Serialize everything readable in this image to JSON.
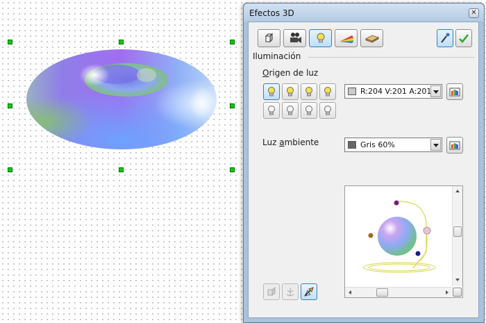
{
  "dialog": {
    "title": "Efectos 3D",
    "close_icon": "close-icon",
    "tabs": [
      {
        "name": "geometry",
        "icon": "cube-icon",
        "active": false
      },
      {
        "name": "shading",
        "icon": "camera-icon",
        "active": false
      },
      {
        "name": "illumination",
        "icon": "lightbulb-icon",
        "active": true
      },
      {
        "name": "textures",
        "icon": "rainbow-icon",
        "active": false
      },
      {
        "name": "material",
        "icon": "material-icon",
        "active": false
      }
    ],
    "assign_icon": "pipette-icon",
    "apply_icon": "checkmark-icon",
    "section_title": "Iluminación",
    "light_source": {
      "label_prefix": "",
      "label_accel": "O",
      "label_rest": "rigen de luz",
      "active_index": 0,
      "bulbs_row1": [
        "lightbulb-on-icon",
        "lightbulb-on-icon",
        "lightbulb-on-icon",
        "lightbulb-on-icon"
      ],
      "bulbs_row2": [
        "lightbulb-off-icon",
        "lightbulb-off-icon",
        "lightbulb-off-icon",
        "lightbulb-off-icon"
      ],
      "color_value": "R:204 V:201 A:201",
      "color_swatch": "#cccac9"
    },
    "ambient": {
      "label_prefix": "Luz ",
      "label_accel": "a",
      "label_rest": "mbiente",
      "value": "Gris 60%",
      "swatch": "#666666"
    },
    "bottom_buttons": [
      {
        "name": "convert-to-3d",
        "enabled": false
      },
      {
        "name": "convert-to-rotation",
        "enabled": false
      },
      {
        "name": "perspective",
        "enabled": true
      }
    ]
  },
  "colors": {
    "handle": "#00d000",
    "active_tab": "#bddff8",
    "light_color": "#dcd44a"
  }
}
